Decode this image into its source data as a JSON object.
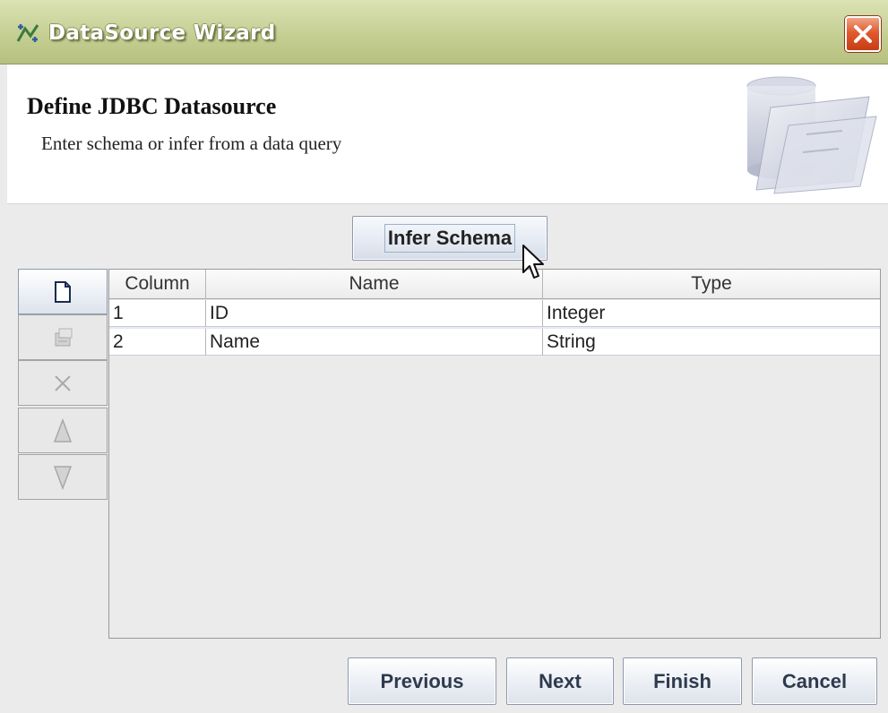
{
  "window": {
    "title": "DataSource Wizard",
    "title_icon": "wizard-icon",
    "close_icon": "close-icon"
  },
  "header": {
    "title": "Define JDBC Datasource",
    "subtitle": "Enter schema or infer from a data query",
    "image": "database-folder-graphic"
  },
  "infer_button": {
    "label": "Infer Schema"
  },
  "toolbar": [
    {
      "name": "new-row",
      "icon": "new-document-icon",
      "enabled": true
    },
    {
      "name": "properties",
      "icon": "properties-icon",
      "enabled": false
    },
    {
      "name": "delete",
      "icon": "delete-icon",
      "enabled": false
    },
    {
      "name": "move-up",
      "icon": "arrow-up-icon",
      "enabled": false
    },
    {
      "name": "move-down",
      "icon": "arrow-down-icon",
      "enabled": false
    }
  ],
  "table": {
    "headers": [
      "Column",
      "Name",
      "Type"
    ],
    "rows": [
      [
        "1",
        "ID",
        "Integer"
      ],
      [
        "2",
        "Name",
        "String"
      ]
    ]
  },
  "footer": {
    "previous": "Previous",
    "next": "Next",
    "finish": "Finish",
    "cancel": "Cancel"
  },
  "colors": {
    "titlebar": "#c5cf93",
    "close_button": "#e05a2e",
    "dialog_background": "#ebebeb"
  }
}
